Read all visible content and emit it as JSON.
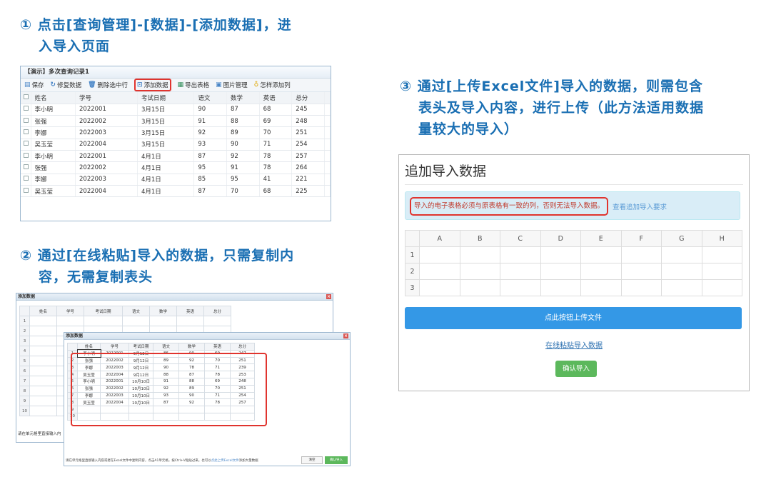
{
  "steps": {
    "s1_line1": "① 点击[查询管理]-[数据]-[添加数据]，进",
    "s1_line2": "入导入页面",
    "s2_line1": "② 通过[在线粘贴]导入的数据，只需复制内",
    "s2_line2": "容，无需复制表头",
    "s3_line1": "③ 通过[上传Excel文件]导入的数据，则需包含",
    "s3_line2": "表头及导入内容，进行上传（此方法适用数据",
    "s3_line3": "量较大的导入）"
  },
  "panel1": {
    "title": "【演示】多次查询记录1",
    "toolbar": [
      "保存",
      "修复数据",
      "删除选中行",
      "添加数据",
      "导出表格",
      "图片管理",
      "怎样添加列"
    ],
    "columns": [
      "姓名",
      "学号",
      "考试日期",
      "语文",
      "数学",
      "英语",
      "总分"
    ],
    "rows": [
      [
        "李小明",
        "2022001",
        "3月15日",
        "90",
        "87",
        "68",
        "245"
      ],
      [
        "张强",
        "2022002",
        "3月15日",
        "91",
        "88",
        "69",
        "248"
      ],
      [
        "李娜",
        "2022003",
        "3月15日",
        "92",
        "89",
        "70",
        "251"
      ],
      [
        "吴玉莹",
        "2022004",
        "3月15日",
        "93",
        "90",
        "71",
        "254"
      ],
      [
        "李小明",
        "2022001",
        "4月1日",
        "87",
        "92",
        "78",
        "257"
      ],
      [
        "张强",
        "2022002",
        "4月1日",
        "95",
        "91",
        "78",
        "264"
      ],
      [
        "李娜",
        "2022003",
        "4月1日",
        "85",
        "95",
        "41",
        "221"
      ],
      [
        "吴玉莹",
        "2022004",
        "4月1日",
        "87",
        "70",
        "68",
        "225"
      ]
    ]
  },
  "panel2": {
    "dialog_title": "添加数据",
    "columns": [
      "姓名",
      "学号",
      "考试日期",
      "语文",
      "数学",
      "英语",
      "总分"
    ],
    "back_footer": "请在单元格里直接输入内",
    "rows": [
      [
        "李小明",
        "2022001",
        "9月12日",
        "86",
        "90",
        "69",
        "247"
      ],
      [
        "张强",
        "2022002",
        "9月12日",
        "89",
        "92",
        "70",
        "251"
      ],
      [
        "李娜",
        "2022003",
        "9月12日",
        "90",
        "78",
        "71",
        "239"
      ],
      [
        "吴玉莹",
        "2022004",
        "9月12日",
        "88",
        "87",
        "78",
        "253"
      ],
      [
        "李小明",
        "2022001",
        "10月10日",
        "91",
        "88",
        "69",
        "248"
      ],
      [
        "张强",
        "2022002",
        "10月10日",
        "92",
        "89",
        "70",
        "251"
      ],
      [
        "李娜",
        "2022003",
        "10月10日",
        "93",
        "90",
        "71",
        "254"
      ],
      [
        "吴玉莹",
        "2022004",
        "10月10日",
        "87",
        "92",
        "78",
        "257"
      ]
    ],
    "footer_text": "请在单元格里直接输入内容或者在Excel文件中复制内容，点击A1单元格，按Ctrl+V粘贴过来。也可以",
    "footer_link": "点此上传Excel文件",
    "footer_tail": "添加大量数据",
    "btn_cancel": "清空",
    "btn_ok": "确认导入"
  },
  "panel3": {
    "heading": "追加导入数据",
    "warning": "导入的电子表格必须与原表格有一致的列，否则无法导入数据。",
    "requirements_link": "查看追加导入要求",
    "col_letters": [
      "A",
      "B",
      "C",
      "D",
      "E",
      "F",
      "G",
      "H"
    ],
    "row_numbers": [
      "1",
      "2",
      "3"
    ],
    "upload_button": "点此按钮上传文件",
    "paste_link": "在线粘贴导入数据",
    "confirm_button": "确认导入"
  },
  "colors": {
    "step_text": "#1a6fb3",
    "highlight": "#e0342e",
    "upload": "#3498e6",
    "confirm": "#5cb85c"
  }
}
